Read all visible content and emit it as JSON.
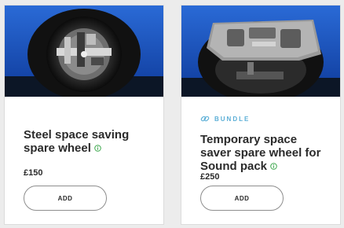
{
  "products": [
    {
      "title": "Steel space saving spare wheel",
      "price": "£150",
      "add_label": "ADD",
      "image": "steel-spare-wheel-in-boot-well"
    },
    {
      "badge": "BUNDLE",
      "title": "Temporary space saver spare wheel for Sound pack",
      "price": "£250",
      "add_label": "ADD",
      "image": "spare-wheel-with-foam-tool-tray"
    }
  ],
  "colors": {
    "accent_badge": "#5aaed6",
    "info_icon": "#3aa64a",
    "car_body": "#1d53c0"
  }
}
